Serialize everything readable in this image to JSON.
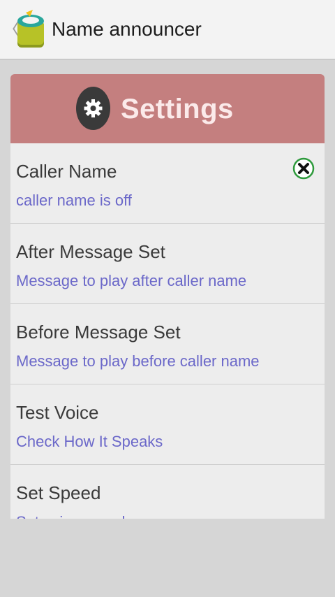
{
  "actionbar": {
    "back_glyph": "〈",
    "app_icon": "app-icon",
    "title": "Name announcer"
  },
  "settings": {
    "title": "Settings",
    "icon": "gear-icon",
    "header_color": "#c47f7f",
    "items": [
      {
        "title": "Caller Name",
        "subtitle": "caller name is off",
        "control": "checkbox-off-icon"
      },
      {
        "title": "After Message Set",
        "subtitle": "Message to play after caller name"
      },
      {
        "title": "Before Message Set",
        "subtitle": "Message to play before caller name"
      },
      {
        "title": "Test Voice",
        "subtitle": "Check How It Speaks"
      },
      {
        "title": "Set Speed",
        "subtitle": "Set voice speed"
      }
    ]
  },
  "colors": {
    "subtitle": "#6b68c9",
    "checkbox_ring": "#2e9a3c"
  }
}
